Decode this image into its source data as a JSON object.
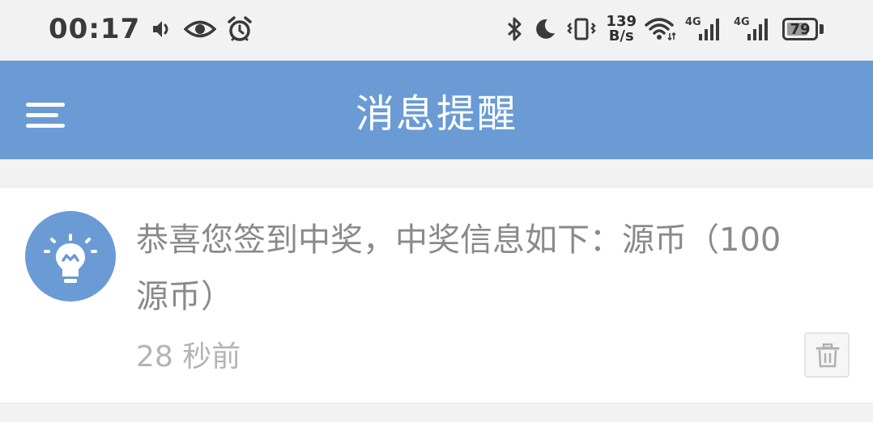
{
  "status_bar": {
    "time": "00:17",
    "net_speed_value": "139",
    "net_speed_unit": "B/s",
    "signal_1_label": "4G",
    "signal_2_label": "4G",
    "battery_level": "79",
    "battery_fraction": 0.79
  },
  "app_bar": {
    "title": "消息提醒"
  },
  "messages": [
    {
      "text": "恭喜您签到中奖，中奖信息如下：源币（100源币）",
      "time_ago": "28 秒前"
    }
  ],
  "colors": {
    "accent": "#6a9bd4",
    "message_text": "#8a8a8a",
    "timestamp_text": "#b4b4b4"
  }
}
